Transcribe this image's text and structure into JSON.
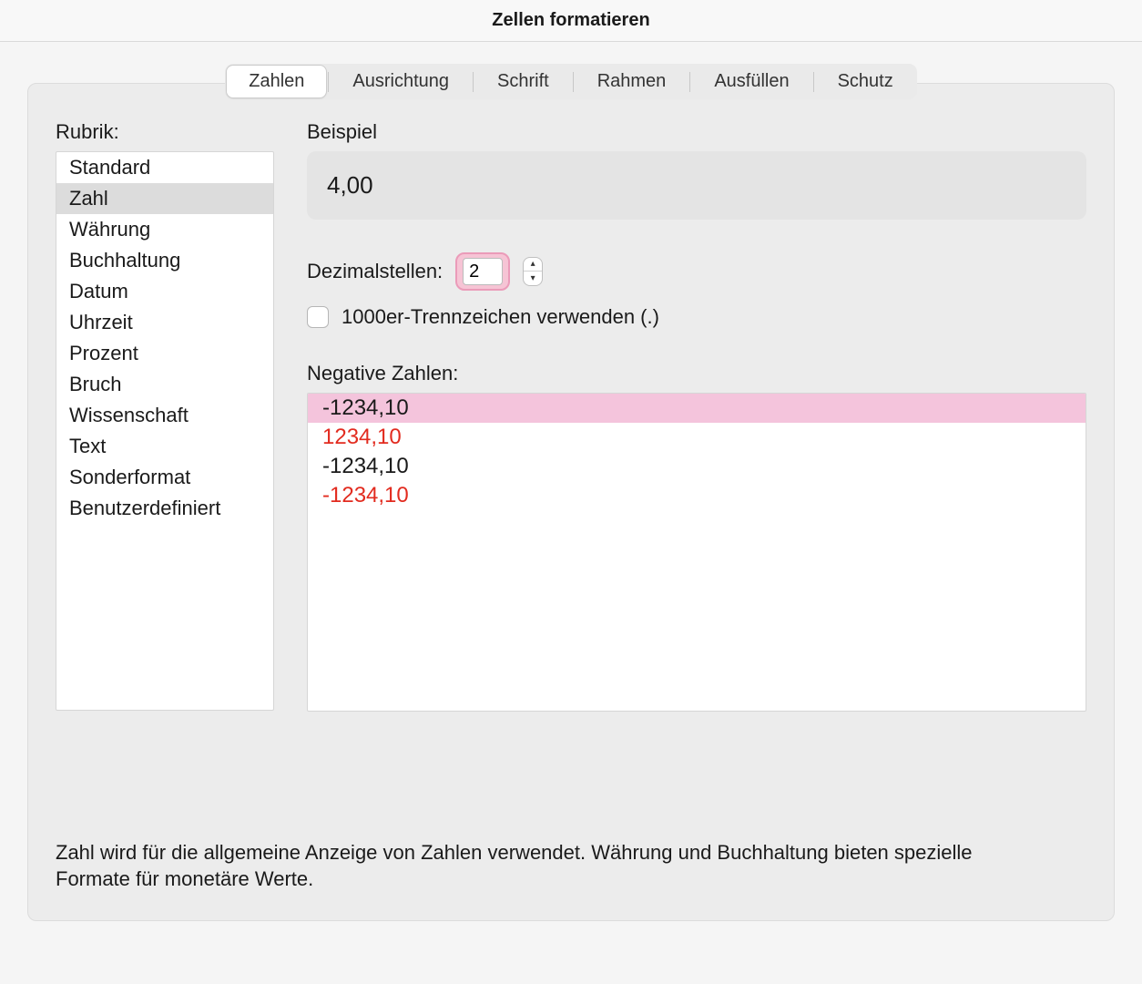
{
  "window": {
    "title": "Zellen formatieren"
  },
  "tabs": {
    "items": [
      {
        "label": "Zahlen"
      },
      {
        "label": "Ausrichtung"
      },
      {
        "label": "Schrift"
      },
      {
        "label": "Rahmen"
      },
      {
        "label": "Ausfüllen"
      },
      {
        "label": "Schutz"
      }
    ],
    "active_index": 0
  },
  "rubrik": {
    "label": "Rubrik:",
    "items": [
      "Standard",
      "Zahl",
      "Währung",
      "Buchhaltung",
      "Datum",
      "Uhrzeit",
      "Prozent",
      "Bruch",
      "Wissenschaft",
      "Text",
      "Sonderformat",
      "Benutzerdefiniert"
    ],
    "selected_index": 1
  },
  "example": {
    "label": "Beispiel",
    "value": "4,00"
  },
  "decimals": {
    "label": "Dezimalstellen:",
    "value": "2"
  },
  "thousands": {
    "checked": false,
    "label": "1000er-Trennzeichen verwenden (.)"
  },
  "negative": {
    "label": "Negative Zahlen:",
    "items": [
      {
        "text": "-1234,10",
        "red": false
      },
      {
        "text": "1234,10",
        "red": true
      },
      {
        "text": "-1234,10",
        "red": false
      },
      {
        "text": "-1234,10",
        "red": true
      }
    ],
    "selected_index": 0
  },
  "footer": {
    "text": "Zahl wird für die allgemeine Anzeige von Zahlen verwendet. Währung und Buchhaltung bieten spezielle Formate für monetäre Werte."
  }
}
